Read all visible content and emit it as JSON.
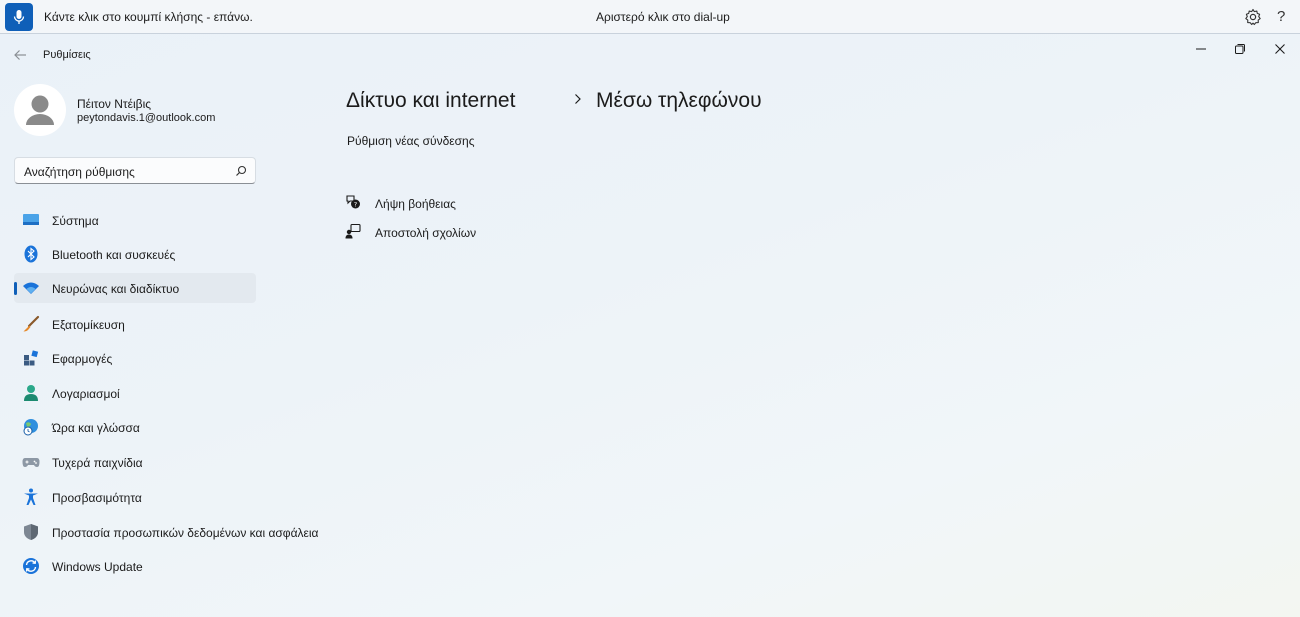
{
  "voice_bar": {
    "hint_text": "Κάντε κλικ στο κουμπί κλήσης - επάνω.",
    "status_text": "Αριστερό κλικ στο dial-up",
    "mic_icon": "microphone-icon",
    "settings_icon": "gear-icon",
    "help_label": "?"
  },
  "window": {
    "title": "Ρυθμίσεις",
    "back_icon": "back-arrow-icon",
    "controls": [
      "minimize-icon",
      "restore-icon",
      "close-icon"
    ]
  },
  "profile": {
    "name": "Πέιτον Ντέιβις",
    "email": "peytondavis.1@outlook.com"
  },
  "search": {
    "placeholder": "Αναζήτηση ρύθμισης",
    "icon": "search-icon"
  },
  "sidebar": {
    "items": [
      {
        "label": "Σύστημα",
        "icon": "display-icon",
        "active": false
      },
      {
        "label": "Bluetooth και συσκευές",
        "icon": "bluetooth-icon",
        "active": false
      },
      {
        "label": "Νευρώνας και διαδίκτυο",
        "icon": "wifi-icon",
        "active": true
      },
      {
        "label": "Εξατομίκευση",
        "icon": "brush-icon",
        "active": false
      },
      {
        "label": "Εφαρμογές",
        "icon": "apps-icon",
        "active": false
      },
      {
        "label": "Λογαριασμοί",
        "icon": "person-icon",
        "active": false
      },
      {
        "label": "Ώρα και γλώσσα",
        "icon": "globe-clock-icon",
        "active": false
      },
      {
        "label": "Τυχερά παιχνίδια",
        "icon": "gamepad-icon",
        "active": false
      },
      {
        "label": "Προσβασιμότητα",
        "icon": "accessibility-icon",
        "active": false
      },
      {
        "label": "Προστασία προσωπικών δεδομένων και ασφάλεια",
        "icon": "shield-icon",
        "active": false
      },
      {
        "label": "Windows Update",
        "icon": "update-icon",
        "active": false
      }
    ]
  },
  "main": {
    "breadcrumb_parent": "Δίκτυο και internet",
    "breadcrumb_current": "Μέσω τηλεφώνου",
    "setup_link": "Ρύθμιση νέας σύνδεσης",
    "help_links": [
      {
        "label": "Λήψη βοήθειας",
        "icon": "help-chat-icon"
      },
      {
        "label": "Αποστολή σχολίων",
        "icon": "feedback-icon"
      }
    ]
  },
  "colors": {
    "accent": "#0f5fb8",
    "active_nav_bg": "#e3e9ef"
  }
}
